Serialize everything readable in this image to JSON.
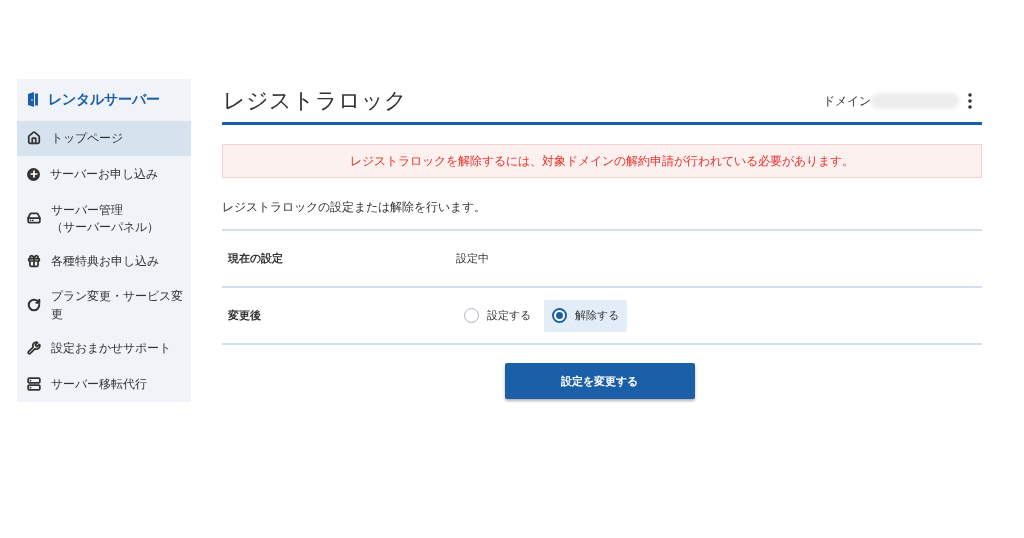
{
  "sidebar": {
    "title": "レンタルサーバー",
    "items": [
      {
        "label": "トップページ",
        "selected": true
      },
      {
        "label": "サーバーお申し込み",
        "selected": false
      },
      {
        "label": "サーバー管理",
        "sublabel": "（サーバーパネル）",
        "selected": false
      },
      {
        "label": "各種特典お申し込み",
        "selected": false
      },
      {
        "label": "プラン変更・サービス変更",
        "selected": false
      },
      {
        "label": "設定おまかせサポート",
        "selected": false
      },
      {
        "label": "サーバー移転代行",
        "selected": false
      }
    ]
  },
  "header": {
    "title": "レジストラロック",
    "domain_label": "ドメイン"
  },
  "alert": "レジストラロックを解除するには、対象ドメインの解約申請が行われている必要があります。",
  "description": "レジストラロックの設定または解除を行います。",
  "form": {
    "rows": [
      {
        "kind": "text",
        "label": "現在の設定",
        "value": "設定中"
      },
      {
        "kind": "radio",
        "label": "変更後",
        "options": [
          {
            "label": "設定する",
            "selected": false
          },
          {
            "label": "解除する",
            "selected": true
          }
        ]
      }
    ]
  },
  "submit": "設定を変更する"
}
